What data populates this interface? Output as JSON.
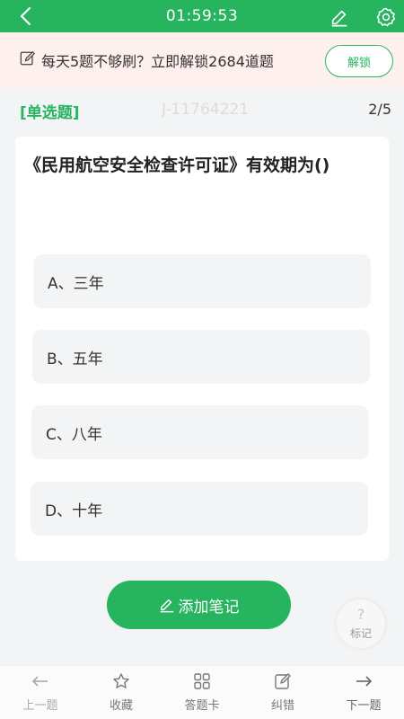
{
  "header": {
    "timer": "01:59:53"
  },
  "promo": {
    "text": "每天5题不够刷？立即解锁2684道题",
    "unlock_label": "解锁"
  },
  "question": {
    "type_label": "[单选题]",
    "id": "J-11764221",
    "progress": "2/5",
    "text": "《民用航空安全检查许可证》有效期为()",
    "options": [
      {
        "label": "A、三年"
      },
      {
        "label": "B、五年"
      },
      {
        "label": "C、八年"
      },
      {
        "label": "D、十年"
      }
    ]
  },
  "actions": {
    "add_note_label": "添加笔记",
    "mark_icon": "?",
    "mark_label": "标记"
  },
  "bottom_nav": [
    {
      "icon": "arrow-left-icon",
      "label": "上一题"
    },
    {
      "icon": "star-icon",
      "label": "收藏"
    },
    {
      "icon": "grid-icon",
      "label": "答题卡"
    },
    {
      "icon": "edit-icon",
      "label": "纠错"
    },
    {
      "icon": "arrow-right-icon",
      "label": "下一题"
    }
  ],
  "colors": {
    "primary": "#27b45f",
    "promo_bg": "#fdf0ed"
  }
}
